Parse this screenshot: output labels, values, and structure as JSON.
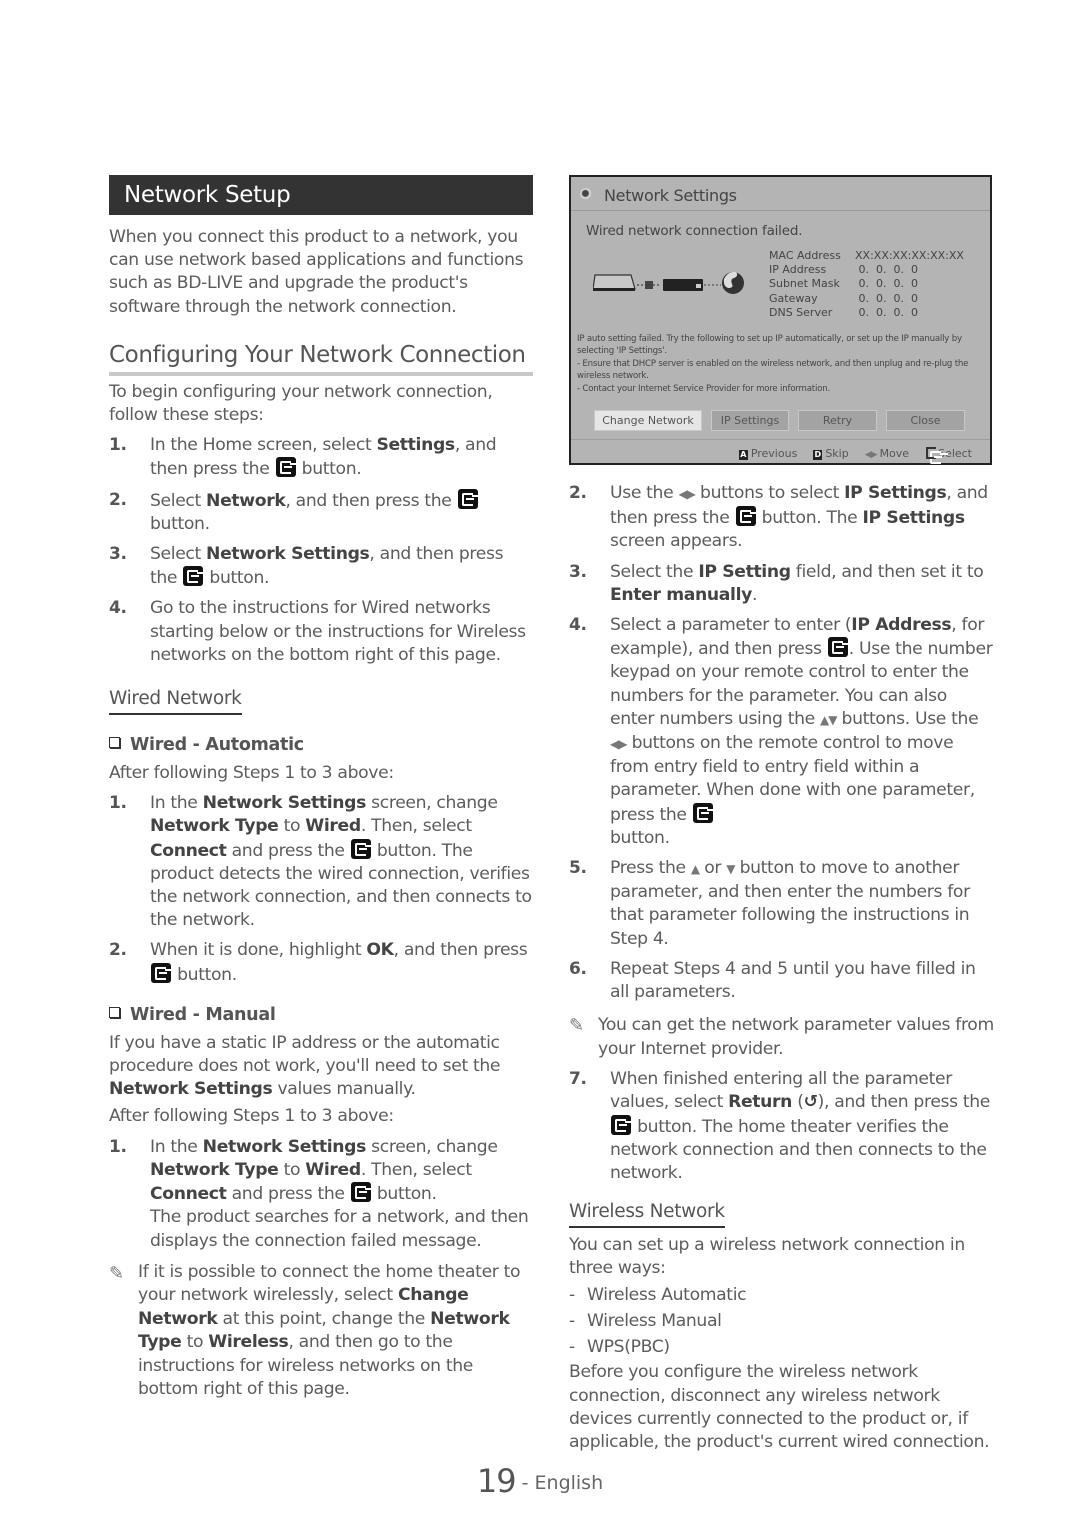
{
  "left": {
    "section_title": "Network Setup",
    "intro": "When you connect this product to a network, you can use network based applications and functions such as BD-LIVE and upgrade the product's software through the network connection.",
    "config_heading": "Configuring Your Network Connection",
    "config_intro": "To begin configuring your network connection, follow these steps:",
    "config_steps": [
      {
        "num": "1.",
        "parts": [
          "In the Home screen, select ",
          "Settings",
          ", and then press the ",
          "button."
        ]
      },
      {
        "num": "2.",
        "parts": [
          "Select ",
          "Network",
          ", and then press the ",
          "button."
        ]
      },
      {
        "num": "3.",
        "parts": [
          "Select ",
          "Network Settings",
          ", and then press the ",
          "button."
        ]
      },
      {
        "num": "4.",
        "text": "Go to the instructions for Wired networks starting below or the instructions for Wireless networks on the bottom right of this page."
      }
    ],
    "wired_heading": "Wired Network",
    "wired_auto": {
      "title": "Wired - Automatic",
      "after": "After following Steps 1 to 3 above:",
      "step1": {
        "num": "1.",
        "a": "In the ",
        "b1": "Network Settings",
        "c": " screen, change ",
        "b2": "Network Type",
        "d": " to ",
        "b3": "Wired",
        "e": ". Then, select ",
        "b4": "Connect",
        "f": " and press the ",
        "g": " button. The product detects the wired connection, verifies the network connection, and then connects to the network."
      },
      "step2": {
        "num": "2.",
        "a": "When it is done, highlight ",
        "b": "OK",
        "c": ", and then press ",
        "d": " button."
      }
    },
    "wired_manual": {
      "title": "Wired - Manual",
      "desc_a": "If you have a static IP address or the automatic procedure does not work, you'll need to set the ",
      "desc_b": "Network Settings",
      "desc_c": " values manually.",
      "after": "After following Steps 1 to 3 above:",
      "step1": {
        "num": "1.",
        "a": "In the ",
        "b1": "Network Settings",
        "c": " screen, change ",
        "b2": "Network Type",
        "d": " to ",
        "b3": "Wired",
        "e": ". Then, select ",
        "b4": "Connect",
        "f": " and press the ",
        "g": " button.",
        "h": "The product searches for a network, and then displays the connection failed message."
      },
      "note": {
        "a": "If it is possible to connect the home theater to your network wirelessly, select ",
        "b1": "Change Network",
        "c": " at this point, change the ",
        "b2": "Network Type",
        "d": " to ",
        "b3": "Wireless",
        "e": ", and then go to the instructions for wireless networks on the bottom right of this page."
      }
    }
  },
  "panel": {
    "title": "Network Settings",
    "status": "Wired network connection failed.",
    "info": [
      {
        "label": "MAC Address",
        "value": "XX:XX:XX:XX:XX:XX"
      },
      {
        "label": "IP Address",
        "value": " 0.  0.  0.  0"
      },
      {
        "label": "Subnet Mask",
        "value": " 0.  0.  0.  0"
      },
      {
        "label": "Gateway",
        "value": " 0.  0.  0.  0"
      },
      {
        "label": "DNS Server",
        "value": " 0.  0.  0.  0"
      }
    ],
    "messages": [
      "IP auto setting failed. Try the following to set up IP automatically, or set up the IP manually by selecting 'IP Settings'.",
      "- Ensure that DHCP server is enabled on the wireless network, and then unplug and re-plug the wireless network.",
      "- Contact your Internet Service Provider for more information."
    ],
    "buttons": [
      "Change Network",
      "IP Settings",
      "Retry",
      "Close"
    ],
    "footer": [
      {
        "key": "A",
        "label": "Previous"
      },
      {
        "key": "D",
        "label": "Skip"
      },
      {
        "key": "◂▸",
        "label": "Move"
      },
      {
        "key": "enter",
        "label": "Select"
      }
    ]
  },
  "right": {
    "step2": {
      "num": "2.",
      "a": "Use the ",
      "arrows": "◀▶",
      "b": " buttons to select ",
      "b1": "IP Settings",
      "c": ", and then press the ",
      "d": " button. The ",
      "b2": "IP Settings",
      "e": " screen appears."
    },
    "step3": {
      "num": "3.",
      "a": "Select the ",
      "b1": "IP Setting",
      "c": " field, and then set it to ",
      "b2": "Enter manually",
      "d": "."
    },
    "step4": {
      "num": "4.",
      "a": "Select a parameter to enter (",
      "b1": "IP Address",
      "c": ", for example), and then press ",
      "d": ". Use the number keypad on your remote control to enter the numbers for the parameter. You can also enter numbers using the ",
      "updown": "▲▼",
      "e": " buttons. Use the ",
      "leftright": "◀▶",
      "f": " buttons on the remote control to move from entry field to entry field within a parameter. When done with one parameter, press the ",
      "g": " button."
    },
    "step5": {
      "num": "5.",
      "a": "Press the ",
      "up": "▲",
      "b": " or ",
      "down": "▼",
      "c": " button to move to another parameter, and then enter the numbers for that parameter following the instructions in Step 4."
    },
    "step6": {
      "num": "6.",
      "text": "Repeat Steps 4 and 5 until you have filled in all parameters."
    },
    "note": "You can get the network parameter values from your Internet provider.",
    "step7": {
      "num": "7.",
      "a": "When finished entering all the parameter values, select ",
      "b1": "Return",
      "c": " (",
      "ret": "↺",
      "d": "), and then press the ",
      "e": " button. The home theater verifies the network connection and then connects to the network."
    },
    "wireless_heading": "Wireless Network",
    "wireless_intro": "You can set up a wireless network connection in three ways:",
    "wireless_ways": [
      "Wireless Automatic",
      "Wireless Manual",
      "WPS(PBC)"
    ],
    "wireless_outro": "Before you configure the wireless network connection, disconnect any wireless network devices currently connected to the product or, if applicable, the product's current wired connection."
  },
  "footer": {
    "page_number": "19",
    "separator": " - ",
    "language": "English"
  }
}
